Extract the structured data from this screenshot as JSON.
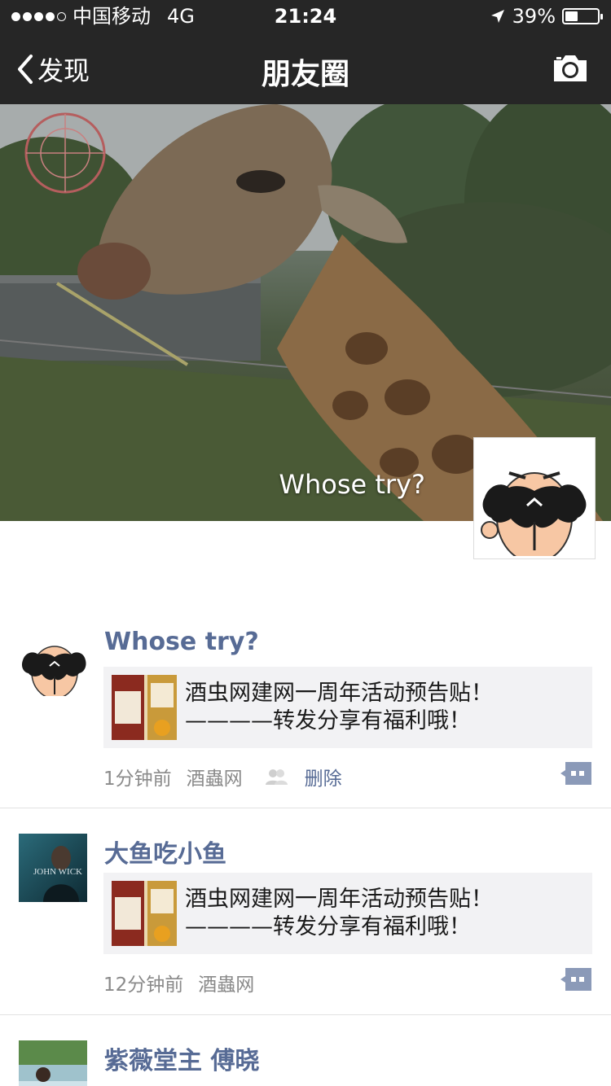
{
  "status_bar": {
    "carrier": "中国移动",
    "network": "4G",
    "time": "21:24",
    "battery": "39%",
    "battery_level": 0.39
  },
  "nav": {
    "back_label": "发现",
    "title": "朋友圈"
  },
  "cover": {
    "name": "Whose try?"
  },
  "posts": [
    {
      "name": "Whose try?",
      "share_text": "酒虫网建网一周年活动预告贴！\n————转发分享有福利哦！",
      "time": "1分钟前",
      "source": "酒蟲网",
      "delete_label": "删除"
    },
    {
      "name": "大鱼吃小鱼",
      "avatar_text": "JOHN WICK",
      "share_text": "酒虫网建网一周年活动预告贴！\n————转发分享有福利哦！",
      "time": "12分钟前",
      "source": "酒蟲网"
    },
    {
      "name": "紫薇堂主 傅晓"
    }
  ],
  "colors": {
    "nav_bg": "#262626",
    "link": "#576b95",
    "share_bg": "#f2f2f4"
  }
}
